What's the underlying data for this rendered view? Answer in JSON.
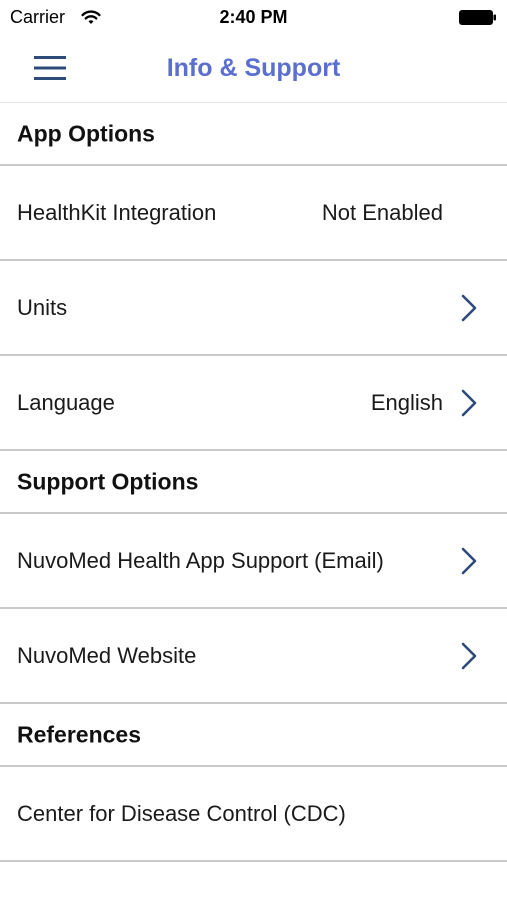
{
  "status_bar": {
    "carrier": "Carrier",
    "time": "2:40 PM"
  },
  "nav": {
    "title": "Info & Support",
    "menu_icon": "hamburger-menu-icon",
    "title_color": "#5b6fcf"
  },
  "sections": {
    "app_options": {
      "header": "App Options",
      "healthkit": {
        "label": "HealthKit Integration",
        "value": "Not Enabled"
      },
      "units": {
        "label": "Units"
      },
      "language": {
        "label": "Language",
        "value": "English"
      }
    },
    "support_options": {
      "header": "Support Options",
      "email_support": {
        "label": "NuvoMed Health App Support (Email)"
      },
      "website": {
        "label": "NuvoMed Website"
      }
    },
    "references": {
      "header": "References",
      "cdc": {
        "label": "Center for Disease Control (CDC)"
      }
    }
  },
  "colors": {
    "accent": "#5b6fcf",
    "chevron": "#2e4a7a",
    "divider": "#c9c9c9"
  }
}
